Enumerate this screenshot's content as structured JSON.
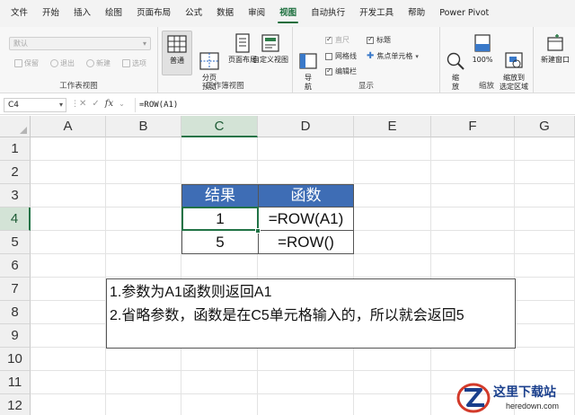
{
  "menu": {
    "items": [
      "文件",
      "开始",
      "插入",
      "绘图",
      "页面布局",
      "公式",
      "数据",
      "审阅",
      "视图",
      "自动执行",
      "开发工具",
      "帮助",
      "Power Pivot"
    ],
    "active_index": 8,
    "accent": "#1a6e3c"
  },
  "ribbon": {
    "sheet_view": {
      "select_value": "默认",
      "keep_label": "保留",
      "exit_label": "退出",
      "new_label": "新建",
      "options_label": "选项",
      "group_label": "工作表视图"
    },
    "workbook_views": {
      "normal_label": "普通",
      "page_break_label": "分页\n预览",
      "page_layout_label": "页面布局",
      "custom_view_label": "自定义视图",
      "group_label": "工作簿视图"
    },
    "show": {
      "navigation_label": "导\n航",
      "ruler_label": "直尺",
      "gridlines_label": "网格线",
      "formula_bar_label": "编辑栏",
      "headings_label": "标题",
      "focus_cell_label": "焦点单元格",
      "group_label": "显示"
    },
    "zoom": {
      "zoom_label": "缩\n放",
      "hundred_label": "100%",
      "zoom_selection_label": "缩放到\n选定区域",
      "group_label": "缩放"
    },
    "window": {
      "new_window_label": "新建窗口"
    }
  },
  "formula_bar": {
    "name_box": "C4",
    "formula": "=ROW(A1)"
  },
  "grid": {
    "columns": [
      "A",
      "B",
      "C",
      "D",
      "E",
      "F",
      "G"
    ],
    "rows": [
      "1",
      "2",
      "3",
      "4",
      "5",
      "6",
      "7",
      "8",
      "9",
      "10",
      "11",
      "12"
    ],
    "active_column": "C",
    "active_row": "4",
    "table": {
      "headers": [
        "结果",
        "函数"
      ],
      "rows": [
        [
          "1",
          "=ROW(A1)"
        ],
        [
          "5",
          "=ROW()"
        ]
      ],
      "header_color": "#3e6db5"
    },
    "notes": [
      "1.参数为A1函数则返回A1",
      "2.省略参数，函数是在C5单元格输入的，所以就会返回5"
    ]
  },
  "watermark": {
    "text": "这里下载站",
    "sub": "heredown.com"
  }
}
